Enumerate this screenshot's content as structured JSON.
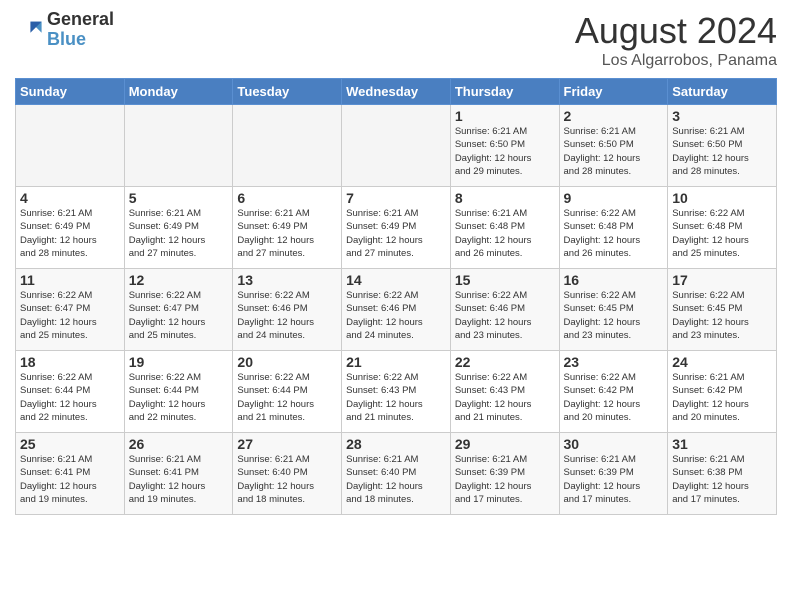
{
  "header": {
    "logo_line1": "General",
    "logo_line2": "Blue",
    "main_title": "August 2024",
    "subtitle": "Los Algarrobos, Panama"
  },
  "days_of_week": [
    "Sunday",
    "Monday",
    "Tuesday",
    "Wednesday",
    "Thursday",
    "Friday",
    "Saturday"
  ],
  "weeks": [
    [
      {
        "num": "",
        "info": ""
      },
      {
        "num": "",
        "info": ""
      },
      {
        "num": "",
        "info": ""
      },
      {
        "num": "",
        "info": ""
      },
      {
        "num": "1",
        "info": "Sunrise: 6:21 AM\nSunset: 6:50 PM\nDaylight: 12 hours\nand 29 minutes."
      },
      {
        "num": "2",
        "info": "Sunrise: 6:21 AM\nSunset: 6:50 PM\nDaylight: 12 hours\nand 28 minutes."
      },
      {
        "num": "3",
        "info": "Sunrise: 6:21 AM\nSunset: 6:50 PM\nDaylight: 12 hours\nand 28 minutes."
      }
    ],
    [
      {
        "num": "4",
        "info": "Sunrise: 6:21 AM\nSunset: 6:49 PM\nDaylight: 12 hours\nand 28 minutes."
      },
      {
        "num": "5",
        "info": "Sunrise: 6:21 AM\nSunset: 6:49 PM\nDaylight: 12 hours\nand 27 minutes."
      },
      {
        "num": "6",
        "info": "Sunrise: 6:21 AM\nSunset: 6:49 PM\nDaylight: 12 hours\nand 27 minutes."
      },
      {
        "num": "7",
        "info": "Sunrise: 6:21 AM\nSunset: 6:49 PM\nDaylight: 12 hours\nand 27 minutes."
      },
      {
        "num": "8",
        "info": "Sunrise: 6:21 AM\nSunset: 6:48 PM\nDaylight: 12 hours\nand 26 minutes."
      },
      {
        "num": "9",
        "info": "Sunrise: 6:22 AM\nSunset: 6:48 PM\nDaylight: 12 hours\nand 26 minutes."
      },
      {
        "num": "10",
        "info": "Sunrise: 6:22 AM\nSunset: 6:48 PM\nDaylight: 12 hours\nand 25 minutes."
      }
    ],
    [
      {
        "num": "11",
        "info": "Sunrise: 6:22 AM\nSunset: 6:47 PM\nDaylight: 12 hours\nand 25 minutes."
      },
      {
        "num": "12",
        "info": "Sunrise: 6:22 AM\nSunset: 6:47 PM\nDaylight: 12 hours\nand 25 minutes."
      },
      {
        "num": "13",
        "info": "Sunrise: 6:22 AM\nSunset: 6:46 PM\nDaylight: 12 hours\nand 24 minutes."
      },
      {
        "num": "14",
        "info": "Sunrise: 6:22 AM\nSunset: 6:46 PM\nDaylight: 12 hours\nand 24 minutes."
      },
      {
        "num": "15",
        "info": "Sunrise: 6:22 AM\nSunset: 6:46 PM\nDaylight: 12 hours\nand 23 minutes."
      },
      {
        "num": "16",
        "info": "Sunrise: 6:22 AM\nSunset: 6:45 PM\nDaylight: 12 hours\nand 23 minutes."
      },
      {
        "num": "17",
        "info": "Sunrise: 6:22 AM\nSunset: 6:45 PM\nDaylight: 12 hours\nand 23 minutes."
      }
    ],
    [
      {
        "num": "18",
        "info": "Sunrise: 6:22 AM\nSunset: 6:44 PM\nDaylight: 12 hours\nand 22 minutes."
      },
      {
        "num": "19",
        "info": "Sunrise: 6:22 AM\nSunset: 6:44 PM\nDaylight: 12 hours\nand 22 minutes."
      },
      {
        "num": "20",
        "info": "Sunrise: 6:22 AM\nSunset: 6:44 PM\nDaylight: 12 hours\nand 21 minutes."
      },
      {
        "num": "21",
        "info": "Sunrise: 6:22 AM\nSunset: 6:43 PM\nDaylight: 12 hours\nand 21 minutes."
      },
      {
        "num": "22",
        "info": "Sunrise: 6:22 AM\nSunset: 6:43 PM\nDaylight: 12 hours\nand 21 minutes."
      },
      {
        "num": "23",
        "info": "Sunrise: 6:22 AM\nSunset: 6:42 PM\nDaylight: 12 hours\nand 20 minutes."
      },
      {
        "num": "24",
        "info": "Sunrise: 6:21 AM\nSunset: 6:42 PM\nDaylight: 12 hours\nand 20 minutes."
      }
    ],
    [
      {
        "num": "25",
        "info": "Sunrise: 6:21 AM\nSunset: 6:41 PM\nDaylight: 12 hours\nand 19 minutes."
      },
      {
        "num": "26",
        "info": "Sunrise: 6:21 AM\nSunset: 6:41 PM\nDaylight: 12 hours\nand 19 minutes."
      },
      {
        "num": "27",
        "info": "Sunrise: 6:21 AM\nSunset: 6:40 PM\nDaylight: 12 hours\nand 18 minutes."
      },
      {
        "num": "28",
        "info": "Sunrise: 6:21 AM\nSunset: 6:40 PM\nDaylight: 12 hours\nand 18 minutes."
      },
      {
        "num": "29",
        "info": "Sunrise: 6:21 AM\nSunset: 6:39 PM\nDaylight: 12 hours\nand 17 minutes."
      },
      {
        "num": "30",
        "info": "Sunrise: 6:21 AM\nSunset: 6:39 PM\nDaylight: 12 hours\nand 17 minutes."
      },
      {
        "num": "31",
        "info": "Sunrise: 6:21 AM\nSunset: 6:38 PM\nDaylight: 12 hours\nand 17 minutes."
      }
    ]
  ]
}
